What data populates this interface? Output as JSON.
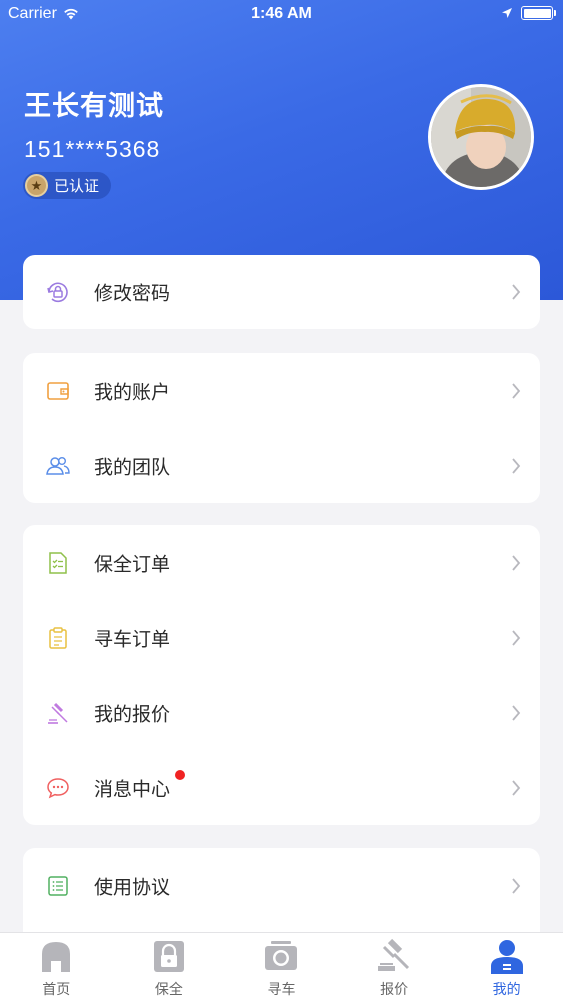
{
  "status_bar": {
    "carrier": "Carrier",
    "time": "1:46 AM"
  },
  "profile": {
    "name": "王长有测试",
    "phone": "151****5368",
    "verified_label": "已认证"
  },
  "menu": {
    "group1": [
      {
        "label": "修改密码",
        "icon": "lock-refresh-icon"
      }
    ],
    "group2": [
      {
        "label": "我的账户",
        "icon": "wallet-icon"
      },
      {
        "label": "我的团队",
        "icon": "team-icon"
      }
    ],
    "group3": [
      {
        "label": "保全订单",
        "icon": "document-list-icon"
      },
      {
        "label": "寻车订单",
        "icon": "clipboard-icon"
      },
      {
        "label": "我的报价",
        "icon": "gavel-icon"
      },
      {
        "label": "消息中心",
        "icon": "chat-bubble-icon",
        "has_unread": true
      }
    ],
    "group4": [
      {
        "label": "使用协议",
        "icon": "agreement-list-icon"
      }
    ]
  },
  "tabbar": {
    "tabs": [
      {
        "label": "首页",
        "icon": "home-icon"
      },
      {
        "label": "保全",
        "icon": "lock-icon"
      },
      {
        "label": "寻车",
        "icon": "camera-icon"
      },
      {
        "label": "报价",
        "icon": "gavel-icon"
      },
      {
        "label": "我的",
        "icon": "person-icon",
        "active": true
      }
    ]
  },
  "colors": {
    "header_gradient_start": "#4d7ff0",
    "header_gradient_end": "#2c58d8",
    "tab_active": "#2f66e0",
    "tab_inactive": "#b5b5ba",
    "unread_dot": "#f02323"
  }
}
